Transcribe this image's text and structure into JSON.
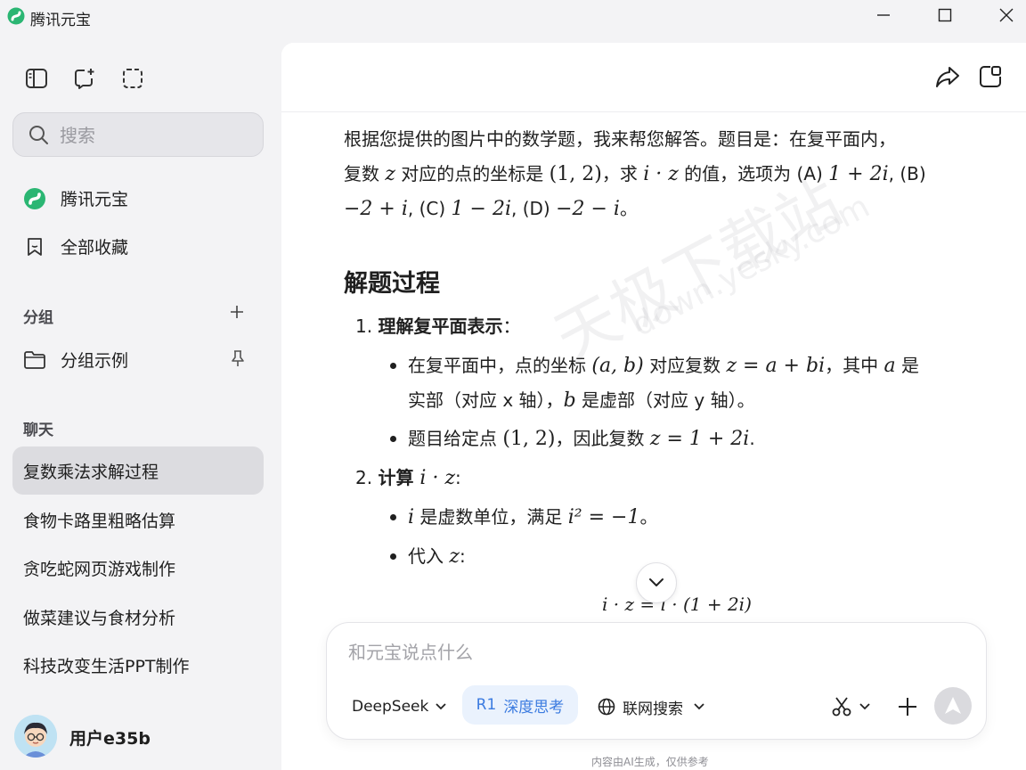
{
  "window": {
    "title": "腾讯元宝"
  },
  "sidebar": {
    "search_placeholder": "搜索",
    "nav": [
      {
        "label": "腾讯元宝",
        "icon": "yuanbao-logo-icon"
      },
      {
        "label": "全部收藏",
        "icon": "bookmark-icon"
      }
    ],
    "groups_title": "分组",
    "groups": [
      {
        "label": "分组示例"
      }
    ],
    "chats_title": "聊天",
    "chats": [
      {
        "label": "复数乘法求解过程",
        "active": true
      },
      {
        "label": "食物卡路里粗略估算"
      },
      {
        "label": "贪吃蛇网页游戏制作"
      },
      {
        "label": "做菜建议与食材分析"
      },
      {
        "label": "科技改变生活PPT制作"
      }
    ],
    "user_name": "用户e35b"
  },
  "answer": {
    "intro_1": "根据您提供的图片中的数学题，我来帮您解答。题目是：在复平面内，",
    "intro_2a": "复数 ",
    "intro_2_z": "z",
    "intro_2b": " 对应的点的坐标是 ",
    "intro_2_pt": "(1, 2)",
    "intro_2c": "，求 ",
    "intro_2_iz": "i · z",
    "intro_2d": " 的值，选项为 (A) ",
    "intro_2_A": "1 + 2i",
    "intro_2e": ", (B)",
    "intro_3_B": "−2 + i",
    "intro_3a": ", (C) ",
    "intro_3_C": "1 − 2i",
    "intro_3b": ", (D) ",
    "intro_3_D": "−2 − i",
    "intro_3c": "。",
    "heading": "解题过程",
    "step1_num": "1.",
    "step1_title": "理解复平面表示",
    "step1_colon": "：",
    "b1_a": "在复平面中，点的坐标 ",
    "b1_ab": "(a, b)",
    "b1_b": " 对应复数 ",
    "b1_eq": "z = a + bi",
    "b1_c": "，其中 ",
    "b1_a_var": "a",
    "b1_d": " 是",
    "b1_line2a": "实部（对应 x 轴），",
    "b1_b_var": "b",
    "b1_line2b": " 是虚部（对应 y 轴）。",
    "b2_a": "题目给定点 ",
    "b2_pt": "(1, 2)",
    "b2_b": "，因此复数 ",
    "b2_eq": "z = 1 + 2i",
    "b2_c": ".",
    "step2_num": "2.",
    "step2_title": "计算 ",
    "step2_expr": "i · z",
    "step2_colon": ":",
    "b3_i": "i",
    "b3_a": " 是虚数单位，满足 ",
    "b3_eq": "i² = −1",
    "b3_b": "。",
    "b4_a": "代入 ",
    "b4_z": "z",
    "b4_b": ":",
    "display_eq": "i · z = i · (1 + 2i)"
  },
  "watermark": {
    "text_1": "天极下载站",
    "text_2": "down.yesky.com"
  },
  "composer": {
    "placeholder": "和元宝说点什么",
    "model": "DeepSeek",
    "deep_think_prefix": "R1",
    "deep_think": "深度思考",
    "web_search": "联网搜索"
  },
  "footer": "内容由AI生成，仅供参考",
  "colors": {
    "accent": "#3b7be0",
    "logo_green": "#2bb673",
    "active_bg": "#dcdce0"
  }
}
